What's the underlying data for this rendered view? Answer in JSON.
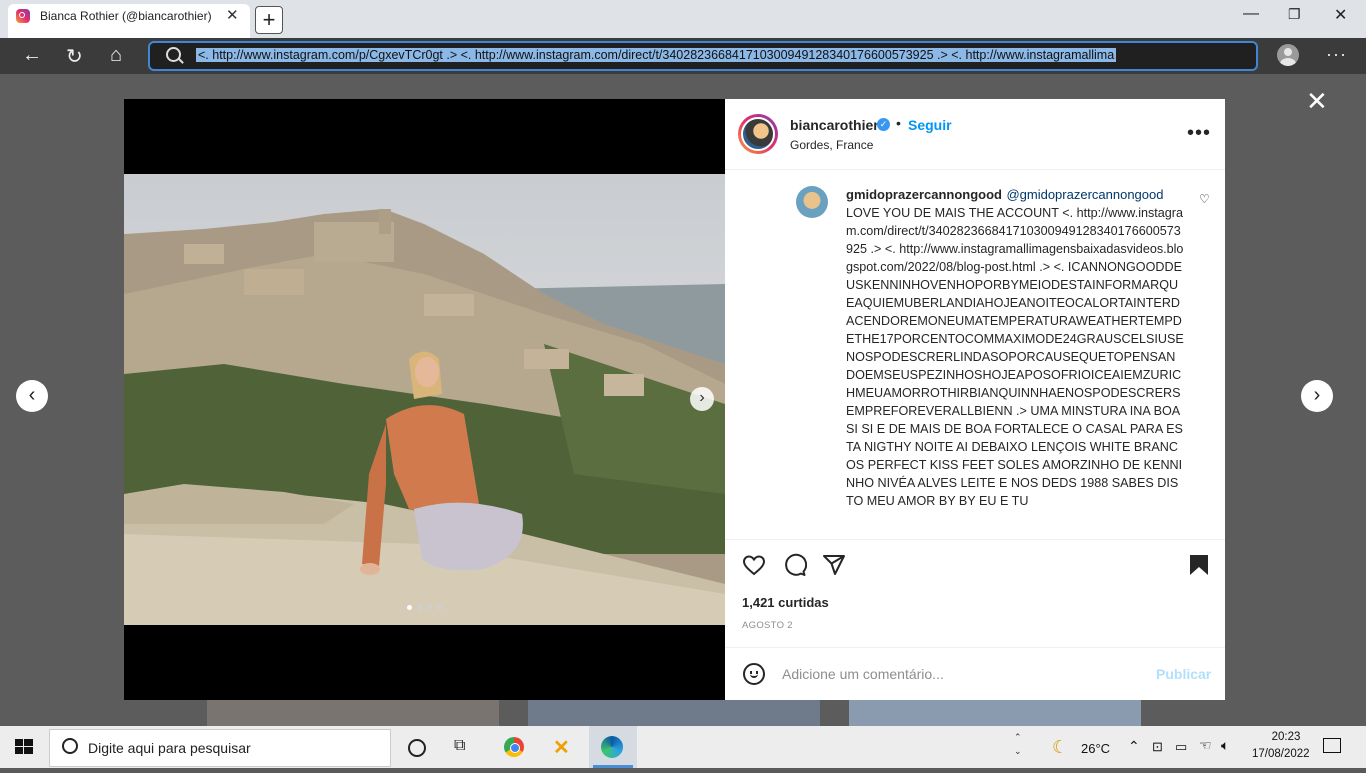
{
  "browser": {
    "tab_title": "Bianca Rothier (@biancarothier)",
    "url": "<. http://www.instagram.com/p/CgxevTCr0gt .> <. http://www.instagram.com/direct/t/340282366841710300949128340176600573925 .> <. http://www.instagramallima"
  },
  "post": {
    "username": "biancarothier",
    "follow_label": "Seguir",
    "location": "Gordes, France",
    "likes": "1,421 curtidas",
    "date": "AGOSTO 2",
    "comment_placeholder": "Adicione um comentário...",
    "publish_label": "Publicar"
  },
  "comment": {
    "username": "gmidoprazercannongood",
    "mention": "@gmidoprazercannongood",
    "text": "LOVE YOU DE MAIS THE ACCOUNT <. http://www.instagram.com/direct/t/340282366841710300949128340176600573925 .> <. http://www.instagramallimagensbaixadasvideos.blogspot.com/2022/08/blog-post.html .> <. ICANNONGOODDEUSKENNINHOVENHOPORBYMEIODESTAINFORMARQUEAQUIEMUBERLANDIAHOJEANOITEOCALORTAINTERDACENDOREMONEUMATEMPERATURAWEATHERTEMPDETHE17PORCENTOCOMMAXIMODE24GRAUSCELSIUSENOSPODESCRERLINDASOPORCAUSEQUETOPENSANDOEMSEUSPEZINHOSHOJEAPOSOFRIOICEAIEMZURICHMEUAMORROTHIRBIANQUINNHAENOSPODESCRERSEMPREFOREVERALLBIENN .> UMA MINSTURA INA BOA SI SI E DE MAIS DE BOA FORTALECE O CASAL PARA ESTA NIGTHY NOITE AI DEBAIXO LENÇOIS WHITE BRANCOS PERFECT KISS FEET SOLES AMORZINHO DE KENNINHO NIVÉA ALVES LEITE E NOS DEDS 1988 SABES DISTO MEU AMOR BY BY EU E TU"
  },
  "taskbar": {
    "search_placeholder": "Digite aqui para pesquisar",
    "temperature": "26°C",
    "time": "20:23",
    "date": "17/08/2022"
  },
  "colors": {
    "accent_blue": "#0095f6",
    "verified_blue": "#3897f0",
    "url_highlight": "#8bb8e6"
  }
}
